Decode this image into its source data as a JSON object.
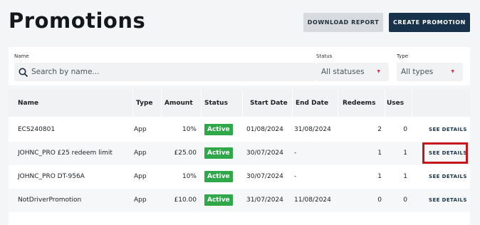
{
  "page": {
    "title": "Promotions"
  },
  "header": {
    "download_label": "DOWNLOAD REPORT",
    "create_label": "CREATE PROMOTION"
  },
  "filters": {
    "name_label": "Name",
    "search_placeholder": "Search by name...",
    "status_label": "Status",
    "status_value": "All statuses",
    "type_label": "Type",
    "type_value": "All types"
  },
  "table": {
    "columns": [
      "Name",
      "Type",
      "Amount",
      "Status",
      "Start Date",
      "End Date",
      "Redeems",
      "Uses"
    ],
    "action_label": "SEE DETAILS",
    "rows": [
      {
        "name": "ECS240801",
        "type": "App",
        "amount": "10%",
        "status": "Active",
        "start": "01/08/2024",
        "end": "31/08/2024",
        "redeems": "2",
        "uses": "0"
      },
      {
        "name": "JOHNC_PRO £25 redeem limit",
        "type": "App",
        "amount": "£25.00",
        "status": "Active",
        "start": "30/07/2024",
        "end": "-",
        "redeems": "1",
        "uses": "1"
      },
      {
        "name": "JOHNC_PRO DT-956A",
        "type": "App",
        "amount": "10%",
        "status": "Active",
        "start": "30/07/2024",
        "end": "-",
        "redeems": "1",
        "uses": "1"
      },
      {
        "name": "NotDriverPromotion",
        "type": "App",
        "amount": "£10.00",
        "status": "Active",
        "start": "31/07/2024",
        "end": "11/08/2024",
        "redeems": "0",
        "uses": "0"
      }
    ]
  },
  "colors": {
    "primary": "#17324a",
    "active_badge": "#2fa84a",
    "highlight": "#c4161c",
    "caret": "#d23a4e"
  }
}
